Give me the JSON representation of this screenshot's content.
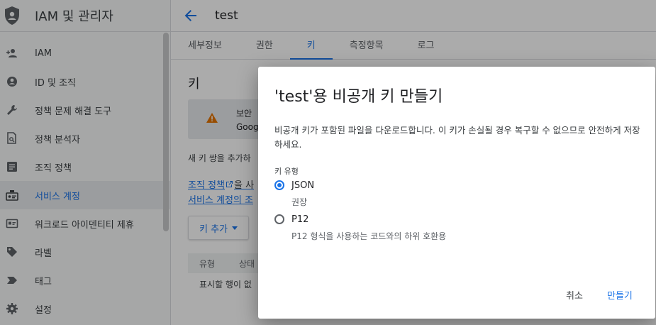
{
  "sidebar": {
    "title": "IAM 및 관리자",
    "items": [
      {
        "label": "IAM",
        "icon": "person-add-icon"
      },
      {
        "label": "ID 및 조직",
        "icon": "account-circle-icon"
      },
      {
        "label": "정책 문제 해결 도구",
        "icon": "wrench-icon"
      },
      {
        "label": "정책 분석자",
        "icon": "document-search-icon"
      },
      {
        "label": "조직 정책",
        "icon": "list-box-icon"
      },
      {
        "label": "서비스 계정",
        "icon": "service-account-icon"
      },
      {
        "label": "워크로드 아이덴티티 제휴",
        "icon": "id-card-icon"
      },
      {
        "label": "라벨",
        "icon": "label-icon"
      },
      {
        "label": "태그",
        "icon": "tag-chevron-icon"
      },
      {
        "label": "설정",
        "icon": "gear-icon"
      }
    ]
  },
  "header": {
    "title": "test"
  },
  "tabs": [
    {
      "label": "세부정보"
    },
    {
      "label": "권한"
    },
    {
      "label": "키"
    },
    {
      "label": "측정항목"
    },
    {
      "label": "로그"
    }
  ],
  "content": {
    "heading": "키",
    "banner_line1": "보안 ",
    "banner_line2": "Goog",
    "description": "새 키 쌍을 추가하",
    "link1": "조직 정책",
    "link1_rest": "을 사",
    "link2": "서비스 계정의 조",
    "add_key": "키 추가",
    "table_col_type": "유형",
    "table_col_status": "상태",
    "empty_text": "표시할 행이 없"
  },
  "dialog": {
    "title": "'test'용 비공개 키 만들기",
    "description": "비공개 키가 포함된 파일을 다운로드합니다. 이 키가 손실될 경우 복구할 수 없으므로 안전하게 저장하세요.",
    "key_type_label": "키 유형",
    "options": [
      {
        "label": "JSON",
        "sub": "권장",
        "selected": true
      },
      {
        "label": "P12",
        "sub": "P12 형식을 사용하는 코드와의 하위 호환용",
        "selected": false
      }
    ],
    "cancel": "취소",
    "create": "만들기"
  },
  "colors": {
    "accent": "#1a73e8",
    "scrim": "rgba(0,0,0,0.33)"
  }
}
